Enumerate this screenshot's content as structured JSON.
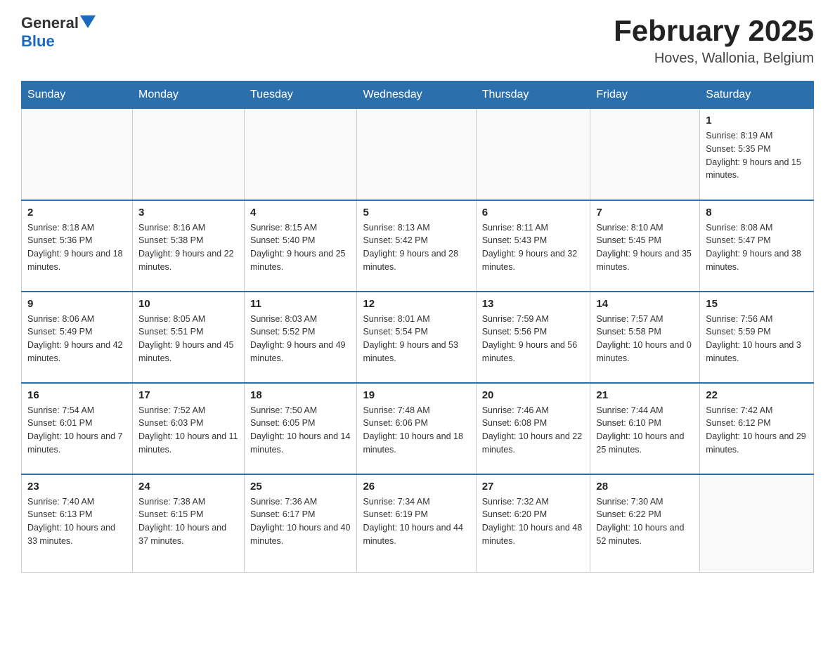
{
  "header": {
    "logo_general": "General",
    "logo_blue": "Blue",
    "month_title": "February 2025",
    "location": "Hoves, Wallonia, Belgium"
  },
  "days_of_week": [
    "Sunday",
    "Monday",
    "Tuesday",
    "Wednesday",
    "Thursday",
    "Friday",
    "Saturday"
  ],
  "weeks": [
    {
      "days": [
        {
          "number": "",
          "info": "",
          "empty": true
        },
        {
          "number": "",
          "info": "",
          "empty": true
        },
        {
          "number": "",
          "info": "",
          "empty": true
        },
        {
          "number": "",
          "info": "",
          "empty": true
        },
        {
          "number": "",
          "info": "",
          "empty": true
        },
        {
          "number": "",
          "info": "",
          "empty": true
        },
        {
          "number": "1",
          "info": "Sunrise: 8:19 AM\nSunset: 5:35 PM\nDaylight: 9 hours and 15 minutes.",
          "empty": false
        }
      ]
    },
    {
      "days": [
        {
          "number": "2",
          "info": "Sunrise: 8:18 AM\nSunset: 5:36 PM\nDaylight: 9 hours and 18 minutes.",
          "empty": false
        },
        {
          "number": "3",
          "info": "Sunrise: 8:16 AM\nSunset: 5:38 PM\nDaylight: 9 hours and 22 minutes.",
          "empty": false
        },
        {
          "number": "4",
          "info": "Sunrise: 8:15 AM\nSunset: 5:40 PM\nDaylight: 9 hours and 25 minutes.",
          "empty": false
        },
        {
          "number": "5",
          "info": "Sunrise: 8:13 AM\nSunset: 5:42 PM\nDaylight: 9 hours and 28 minutes.",
          "empty": false
        },
        {
          "number": "6",
          "info": "Sunrise: 8:11 AM\nSunset: 5:43 PM\nDaylight: 9 hours and 32 minutes.",
          "empty": false
        },
        {
          "number": "7",
          "info": "Sunrise: 8:10 AM\nSunset: 5:45 PM\nDaylight: 9 hours and 35 minutes.",
          "empty": false
        },
        {
          "number": "8",
          "info": "Sunrise: 8:08 AM\nSunset: 5:47 PM\nDaylight: 9 hours and 38 minutes.",
          "empty": false
        }
      ]
    },
    {
      "days": [
        {
          "number": "9",
          "info": "Sunrise: 8:06 AM\nSunset: 5:49 PM\nDaylight: 9 hours and 42 minutes.",
          "empty": false
        },
        {
          "number": "10",
          "info": "Sunrise: 8:05 AM\nSunset: 5:51 PM\nDaylight: 9 hours and 45 minutes.",
          "empty": false
        },
        {
          "number": "11",
          "info": "Sunrise: 8:03 AM\nSunset: 5:52 PM\nDaylight: 9 hours and 49 minutes.",
          "empty": false
        },
        {
          "number": "12",
          "info": "Sunrise: 8:01 AM\nSunset: 5:54 PM\nDaylight: 9 hours and 53 minutes.",
          "empty": false
        },
        {
          "number": "13",
          "info": "Sunrise: 7:59 AM\nSunset: 5:56 PM\nDaylight: 9 hours and 56 minutes.",
          "empty": false
        },
        {
          "number": "14",
          "info": "Sunrise: 7:57 AM\nSunset: 5:58 PM\nDaylight: 10 hours and 0 minutes.",
          "empty": false
        },
        {
          "number": "15",
          "info": "Sunrise: 7:56 AM\nSunset: 5:59 PM\nDaylight: 10 hours and 3 minutes.",
          "empty": false
        }
      ]
    },
    {
      "days": [
        {
          "number": "16",
          "info": "Sunrise: 7:54 AM\nSunset: 6:01 PM\nDaylight: 10 hours and 7 minutes.",
          "empty": false
        },
        {
          "number": "17",
          "info": "Sunrise: 7:52 AM\nSunset: 6:03 PM\nDaylight: 10 hours and 11 minutes.",
          "empty": false
        },
        {
          "number": "18",
          "info": "Sunrise: 7:50 AM\nSunset: 6:05 PM\nDaylight: 10 hours and 14 minutes.",
          "empty": false
        },
        {
          "number": "19",
          "info": "Sunrise: 7:48 AM\nSunset: 6:06 PM\nDaylight: 10 hours and 18 minutes.",
          "empty": false
        },
        {
          "number": "20",
          "info": "Sunrise: 7:46 AM\nSunset: 6:08 PM\nDaylight: 10 hours and 22 minutes.",
          "empty": false
        },
        {
          "number": "21",
          "info": "Sunrise: 7:44 AM\nSunset: 6:10 PM\nDaylight: 10 hours and 25 minutes.",
          "empty": false
        },
        {
          "number": "22",
          "info": "Sunrise: 7:42 AM\nSunset: 6:12 PM\nDaylight: 10 hours and 29 minutes.",
          "empty": false
        }
      ]
    },
    {
      "days": [
        {
          "number": "23",
          "info": "Sunrise: 7:40 AM\nSunset: 6:13 PM\nDaylight: 10 hours and 33 minutes.",
          "empty": false
        },
        {
          "number": "24",
          "info": "Sunrise: 7:38 AM\nSunset: 6:15 PM\nDaylight: 10 hours and 37 minutes.",
          "empty": false
        },
        {
          "number": "25",
          "info": "Sunrise: 7:36 AM\nSunset: 6:17 PM\nDaylight: 10 hours and 40 minutes.",
          "empty": false
        },
        {
          "number": "26",
          "info": "Sunrise: 7:34 AM\nSunset: 6:19 PM\nDaylight: 10 hours and 44 minutes.",
          "empty": false
        },
        {
          "number": "27",
          "info": "Sunrise: 7:32 AM\nSunset: 6:20 PM\nDaylight: 10 hours and 48 minutes.",
          "empty": false
        },
        {
          "number": "28",
          "info": "Sunrise: 7:30 AM\nSunset: 6:22 PM\nDaylight: 10 hours and 52 minutes.",
          "empty": false
        },
        {
          "number": "",
          "info": "",
          "empty": true
        }
      ]
    }
  ]
}
